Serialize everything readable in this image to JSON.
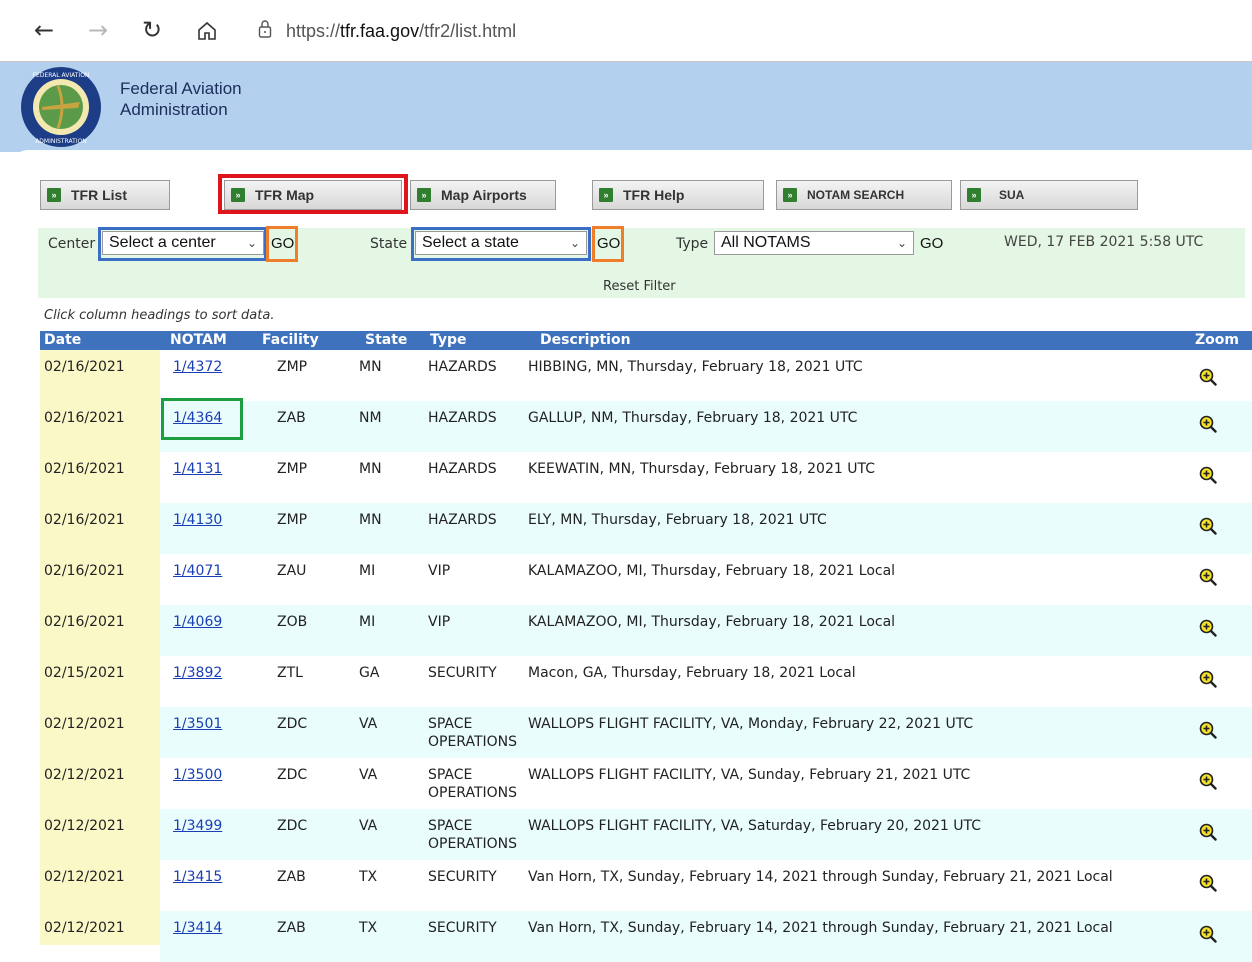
{
  "browser": {
    "url_prefix": "https://",
    "url_domain": "tfr.faa.gov",
    "url_path": "/tfr2/list.html"
  },
  "header": {
    "org_line1": "Federal Aviation",
    "org_line2": "Administration"
  },
  "tabs": [
    {
      "label": "TFR List"
    },
    {
      "label": "TFR Map"
    },
    {
      "label": "Map Airports"
    },
    {
      "label": "TFR Help"
    },
    {
      "label": "NOTAM SEARCH"
    },
    {
      "label": "SUA"
    }
  ],
  "filters": {
    "center_label": "Center",
    "center_value": "Select a center",
    "state_label": "State",
    "state_value": "Select a state",
    "type_label": "Type",
    "type_value": "All NOTAMS",
    "go_label": "GO",
    "datestamp": "WED, 17 FEB 2021 5:58 UTC",
    "reset_label": "Reset Filter"
  },
  "hint": "Click column headings to sort data.",
  "table": {
    "headers": {
      "date": "Date",
      "notam": "NOTAM",
      "facility": "Facility",
      "state": "State",
      "type": "Type",
      "description": "Description",
      "zoom": "Zoom"
    },
    "rows": [
      {
        "date": "02/16/2021",
        "notam": "1/4372",
        "facility": "ZMP",
        "state": "MN",
        "type": "HAZARDS",
        "type2": "",
        "description": "HIBBING, MN, Thursday, February 18, 2021 UTC"
      },
      {
        "date": "02/16/2021",
        "notam": "1/4364",
        "facility": "ZAB",
        "state": "NM",
        "type": "HAZARDS",
        "type2": "",
        "description": "GALLUP, NM, Thursday, February 18, 2021 UTC"
      },
      {
        "date": "02/16/2021",
        "notam": "1/4131",
        "facility": "ZMP",
        "state": "MN",
        "type": "HAZARDS",
        "type2": "",
        "description": "KEEWATIN, MN, Thursday, February 18, 2021 UTC"
      },
      {
        "date": "02/16/2021",
        "notam": "1/4130",
        "facility": "ZMP",
        "state": "MN",
        "type": "HAZARDS",
        "type2": "",
        "description": "ELY, MN, Thursday, February 18, 2021 UTC"
      },
      {
        "date": "02/16/2021",
        "notam": "1/4071",
        "facility": "ZAU",
        "state": "MI",
        "type": "VIP",
        "type2": "",
        "description": "KALAMAZOO, MI, Thursday, February 18, 2021 Local"
      },
      {
        "date": "02/16/2021",
        "notam": "1/4069",
        "facility": "ZOB",
        "state": "MI",
        "type": "VIP",
        "type2": "",
        "description": "KALAMAZOO, MI, Thursday, February 18, 2021 Local"
      },
      {
        "date": "02/15/2021",
        "notam": "1/3892",
        "facility": "ZTL",
        "state": "GA",
        "type": "SECURITY",
        "type2": "",
        "description": "Macon, GA, Thursday, February 18, 2021 Local"
      },
      {
        "date": "02/12/2021",
        "notam": "1/3501",
        "facility": "ZDC",
        "state": "VA",
        "type": "SPACE",
        "type2": "OPERATIONS",
        "description": "WALLOPS FLIGHT FACILITY, VA, Monday, February 22, 2021 UTC"
      },
      {
        "date": "02/12/2021",
        "notam": "1/3500",
        "facility": "ZDC",
        "state": "VA",
        "type": "SPACE",
        "type2": "OPERATIONS",
        "description": "WALLOPS FLIGHT FACILITY, VA, Sunday, February 21, 2021 UTC"
      },
      {
        "date": "02/12/2021",
        "notam": "1/3499",
        "facility": "ZDC",
        "state": "VA",
        "type": "SPACE",
        "type2": "OPERATIONS",
        "description": "WALLOPS FLIGHT FACILITY, VA, Saturday, February 20, 2021 UTC"
      },
      {
        "date": "02/12/2021",
        "notam": "1/3415",
        "facility": "ZAB",
        "state": "TX",
        "type": "SECURITY",
        "type2": "",
        "description": "Van Horn, TX, Sunday, February 14, 2021 through Sunday, February 21, 2021 Local"
      },
      {
        "date": "02/12/2021",
        "notam": "1/3414",
        "facility": "ZAB",
        "state": "TX",
        "type": "SECURITY",
        "type2": "",
        "description": "Van Horn, TX, Sunday, February 14, 2021 through Sunday, February 21, 2021 Local"
      }
    ]
  },
  "icons": {
    "back": "back-arrow-icon",
    "forward": "forward-arrow-icon",
    "reload": "reload-icon",
    "home": "home-icon",
    "lock": "lock-icon",
    "tab_arrow": "double-chevron-icon",
    "zoom": "zoom-in-icon",
    "chevron": "chevron-down-icon"
  },
  "colors": {
    "header_band": "#b3d1ef",
    "table_header": "#3f72bd",
    "date_column": "#fbf8c8",
    "alt_row": "#eafdfd",
    "filter_bar": "#e4f6e4",
    "link": "#1a3fb4",
    "highlight_red": "#e0151b",
    "highlight_blue": "#3b6fc5",
    "highlight_orange": "#ef7d2a",
    "highlight_green": "#1e9e41"
  }
}
